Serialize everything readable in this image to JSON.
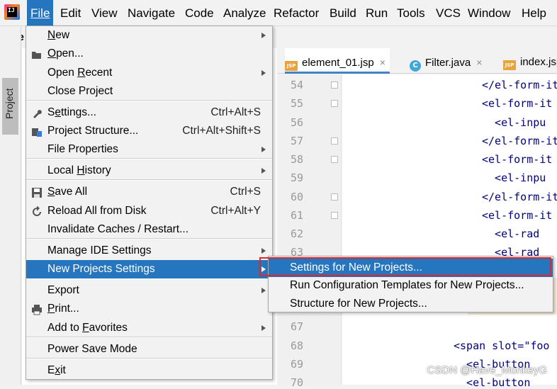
{
  "menubar": {
    "items": [
      "File",
      "Edit",
      "View",
      "Navigate",
      "Code",
      "Analyze",
      "Refactor",
      "Build",
      "Run",
      "Tools",
      "VCS",
      "Window",
      "Help"
    ],
    "active": "File"
  },
  "nav": {
    "project_prefix": "we"
  },
  "project_tab": {
    "label": "Project"
  },
  "editor": {
    "tabs": [
      {
        "label": "element_01.jsp",
        "icon": "jsp-file-icon",
        "active": true
      },
      {
        "label": "Filter.java",
        "icon": "java-class-icon",
        "active": false
      },
      {
        "label": "index.jsp",
        "icon": "jsp-file-icon",
        "active": false
      }
    ],
    "line_numbers": [
      "54",
      "55",
      "56",
      "57",
      "58",
      "59",
      "60",
      "61",
      "62",
      "63",
      "",
      "",
      "",
      "67",
      "68",
      "69",
      "70"
    ],
    "code_lines": [
      "</el-form-it",
      "<el-form-it",
      "  <el-inpu",
      "</el-form-it",
      "<el-form-it",
      "  <el-inpu",
      "</el-form-it",
      "<el-form-it",
      "  <el-rad",
      "  <el-rad",
      "<span slot=\"foo",
      "  <el-button",
      "  <el-button"
    ]
  },
  "file_menu": {
    "items": [
      {
        "label": "New",
        "mnemonic_index": 0,
        "shortcut": "",
        "submenu": true,
        "icon": ""
      },
      {
        "label": "Open...",
        "mnemonic_index": 0,
        "shortcut": "",
        "submenu": false,
        "icon": "folder-open-icon"
      },
      {
        "label": "Open Recent",
        "mnemonic_index": 5,
        "shortcut": "",
        "submenu": true,
        "icon": ""
      },
      {
        "label": "Close Project",
        "mnemonic_index": -1,
        "shortcut": "",
        "submenu": false,
        "icon": ""
      },
      {
        "label": "Settings...",
        "mnemonic_index": 1,
        "shortcut": "Ctrl+Alt+S",
        "submenu": false,
        "icon": "wrench-icon"
      },
      {
        "label": "Project Structure...",
        "mnemonic_index": -1,
        "shortcut": "Ctrl+Alt+Shift+S",
        "submenu": false,
        "icon": "project-structure-icon"
      },
      {
        "label": "File Properties",
        "mnemonic_index": -1,
        "shortcut": "",
        "submenu": true,
        "icon": ""
      },
      {
        "label": "Local History",
        "mnemonic_index": 6,
        "shortcut": "",
        "submenu": true,
        "icon": ""
      },
      {
        "label": "Save All",
        "mnemonic_index": 0,
        "shortcut": "Ctrl+S",
        "submenu": false,
        "icon": "save-icon"
      },
      {
        "label": "Reload All from Disk",
        "mnemonic_index": -1,
        "shortcut": "Ctrl+Alt+Y",
        "submenu": false,
        "icon": "reload-icon"
      },
      {
        "label": "Invalidate Caches / Restart...",
        "mnemonic_index": -1,
        "shortcut": "",
        "submenu": false,
        "icon": ""
      },
      {
        "label": "Manage IDE Settings",
        "mnemonic_index": -1,
        "shortcut": "",
        "submenu": true,
        "icon": ""
      },
      {
        "label": "New Projects Settings",
        "mnemonic_index": -1,
        "shortcut": "",
        "submenu": true,
        "icon": "",
        "selected": true
      },
      {
        "label": "Export",
        "mnemonic_index": -1,
        "shortcut": "",
        "submenu": true,
        "icon": ""
      },
      {
        "label": "Print...",
        "mnemonic_index": 0,
        "shortcut": "",
        "submenu": false,
        "icon": "print-icon"
      },
      {
        "label": "Add to Favorites",
        "mnemonic_index": 7,
        "shortcut": "",
        "submenu": true,
        "icon": ""
      },
      {
        "label": "Power Save Mode",
        "mnemonic_index": -1,
        "shortcut": "",
        "submenu": false,
        "icon": ""
      },
      {
        "label": "Exit",
        "mnemonic_index": 1,
        "shortcut": "",
        "submenu": false,
        "icon": ""
      }
    ]
  },
  "submenu": {
    "items": [
      {
        "label": "Settings for New Projects...",
        "selected": true
      },
      {
        "label": "Run Configuration Templates for New Projects...",
        "selected": false
      },
      {
        "label": "Structure for New Projects...",
        "selected": false
      }
    ]
  },
  "watermark": "CSDN @Have_MonkeyG",
  "colors": {
    "selection": "#2675bf",
    "highlight_box": "#e0262d",
    "menu_bg": "#f2f2f2"
  }
}
